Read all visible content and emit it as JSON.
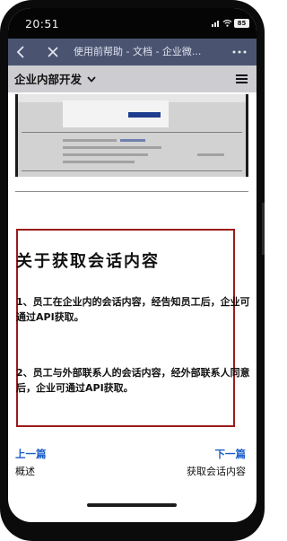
{
  "status_bar": {
    "time": "20:51",
    "battery": "85",
    "icons": [
      "signal-icon",
      "wifi-icon",
      "battery-icon"
    ]
  },
  "nav_bar": {
    "back_icon": "chevron-left-icon",
    "close_icon": "close-icon",
    "title": "使用前帮助 - 文档 - 企业微...",
    "more_icon": "more-icon"
  },
  "section_header": {
    "title": "企业内部开发",
    "dropdown_icon": "chevron-down-icon",
    "menu_icon": "hamburger-icon"
  },
  "article": {
    "heading": "关于获取会话内容",
    "paragraphs": [
      "1、员工在企业内的会话内容，经告知员工后，企业可通过API获取。",
      "2、员工与外部联系人的会话内容，经外部联系人同意后，企业可通过API获取。"
    ]
  },
  "pager": {
    "prev_label": "上一篇",
    "prev_title": "概述",
    "next_label": "下一篇",
    "next_title": "获取会话内容"
  },
  "colors": {
    "nav_bar_bg": "#4a5471",
    "section_header_bg": "#cdcdd1",
    "link": "#1b5ec9",
    "highlight_border": "#9b1b1b"
  }
}
